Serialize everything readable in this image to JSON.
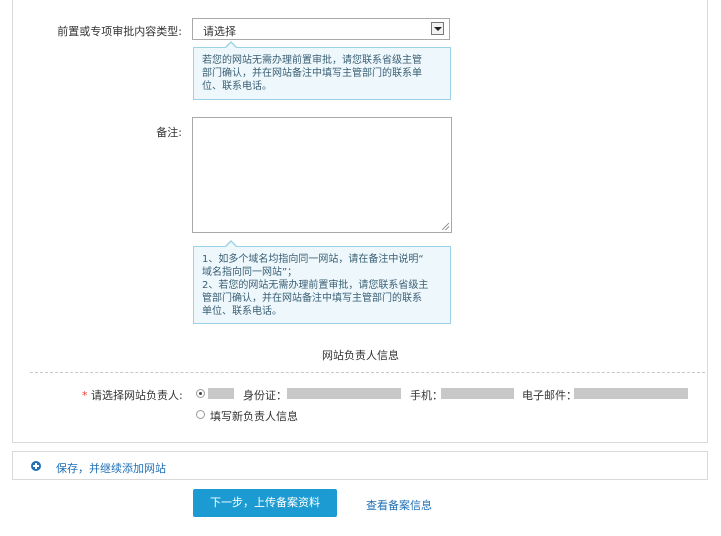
{
  "form": {
    "approval_type_label": "前置或专项审批内容类型:",
    "approval_type_value": "请选择",
    "approval_tip": [
      "若您的网站无需办理前置审批，请您联系省级主管",
      "部门确认，并在网站备注中填写主管部门的联系单",
      "位、联系电话。"
    ],
    "remark_label": "备注:",
    "remark_value": "",
    "remark_tip": [
      "1、如多个域名均指向同一网站，请在备注中说明“",
      "域名指向同一网站”；",
      "2、若您的网站无需办理前置审批，请您联系省级主",
      "管部门确认，并在网站备注中填写主管部门的联系",
      "单位、联系电话。"
    ]
  },
  "owner": {
    "section_title": "网站负责人信息",
    "label_required": "*",
    "label": "请选择网站负责人:",
    "option_existing_id_label": "身份证：",
    "option_existing_phone_label": "手机：",
    "option_existing_email_label": "电子邮件：",
    "option_new": "填写新负责人信息"
  },
  "actions": {
    "save_continue": "保存，并继续添加网站",
    "next_upload": "下一步，上传备案资料",
    "view_info": "查看备案信息"
  },
  "colors": {
    "accent": "#1b9bd1",
    "link": "#1e6fb5",
    "tip_bg": "#eef8fc",
    "tip_border": "#9dd2e6"
  }
}
